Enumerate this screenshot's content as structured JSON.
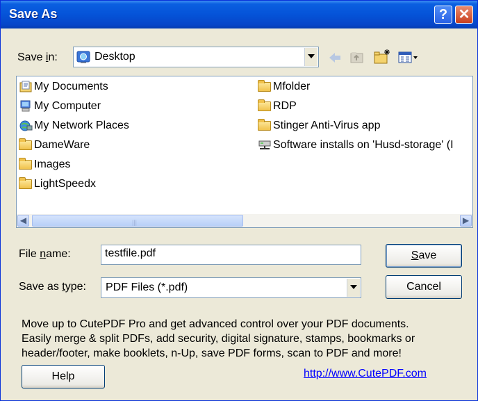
{
  "window": {
    "title": "Save As",
    "help_icon": "?",
    "close_icon": "✕"
  },
  "save_in": {
    "label_pre": "Save ",
    "label_key": "i",
    "label_post": "n:",
    "value": "Desktop"
  },
  "toolbar": {
    "back_icon": "back-arrow-icon",
    "up_icon": "up-folder-icon",
    "new_folder_icon": "new-folder-icon",
    "views_icon": "views-menu-icon"
  },
  "files": {
    "col1": [
      {
        "name": "My Documents",
        "icon": "my-documents-icon"
      },
      {
        "name": "My Computer",
        "icon": "my-computer-icon"
      },
      {
        "name": "My Network Places",
        "icon": "network-places-icon"
      },
      {
        "name": "DameWare",
        "icon": "folder-icon"
      },
      {
        "name": "Images",
        "icon": "folder-icon"
      },
      {
        "name": "LightSpeedx",
        "icon": "folder-icon"
      }
    ],
    "col2": [
      {
        "name": "Mfolder",
        "icon": "folder-icon"
      },
      {
        "name": "RDP",
        "icon": "folder-icon"
      },
      {
        "name": "Stinger Anti-Virus app",
        "icon": "folder-icon"
      },
      {
        "name": "Software installs on 'Husd-storage' (I",
        "icon": "network-drive-icon"
      }
    ]
  },
  "file_name": {
    "label_pre": "File ",
    "label_key": "n",
    "label_post": "ame:",
    "value": "testfile.pdf"
  },
  "save_type": {
    "label_pre": "Save as ",
    "label_key": "t",
    "label_post": "ype:",
    "value": "PDF Files (*.pdf)"
  },
  "buttons": {
    "save_key": "S",
    "save_rest": "ave",
    "cancel": "Cancel",
    "help": "Help"
  },
  "promo": {
    "line1": "Move up to CutePDF Pro and get advanced control over your PDF documents.",
    "line2": "Easily merge & split PDFs, add security, digital signature, stamps, bookmarks or",
    "line3": "header/footer, make booklets, n-Up, save PDF forms, scan to PDF and more!"
  },
  "link": "http://www.CutePDF.com",
  "colors": {
    "titlebar": "#0553D8",
    "face": "#ECE9D8",
    "border": "#7F9DB9",
    "link": "#0000FF"
  }
}
